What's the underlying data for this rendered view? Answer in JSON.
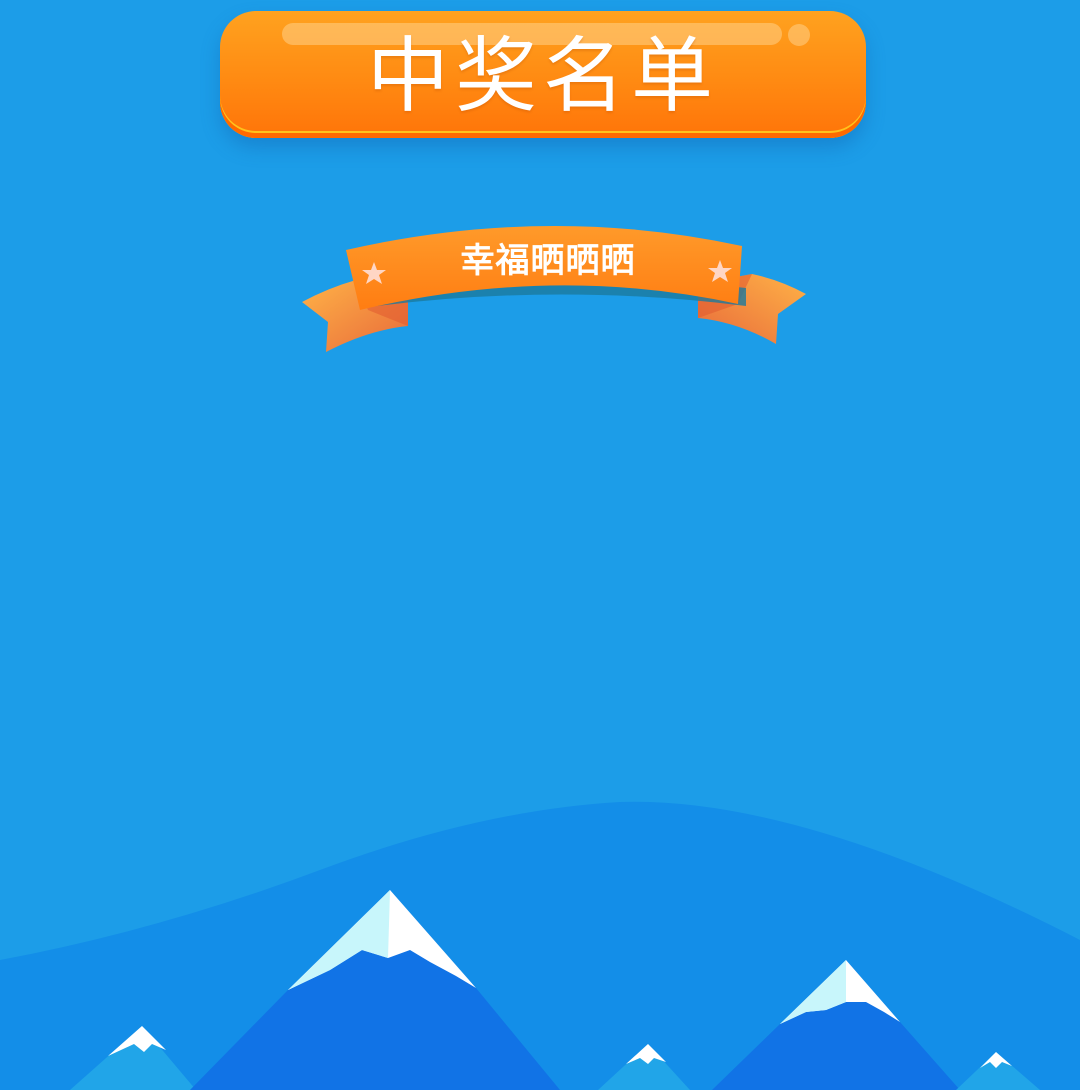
{
  "header": {
    "title": "中奖名单"
  },
  "banner": {
    "text": "幸福晒晒晒",
    "star_icon_left": "star-icon",
    "star_icon_right": "star-icon"
  },
  "colors": {
    "background": "#1c9de8",
    "button_orange": "#ff8a12",
    "ribbon_orange": "#ff8a1f",
    "hill_blue": "#138ee8",
    "mountain_blue": "#1173e6",
    "snow": "#ffffff",
    "snow_shade": "#c8f6fb"
  }
}
